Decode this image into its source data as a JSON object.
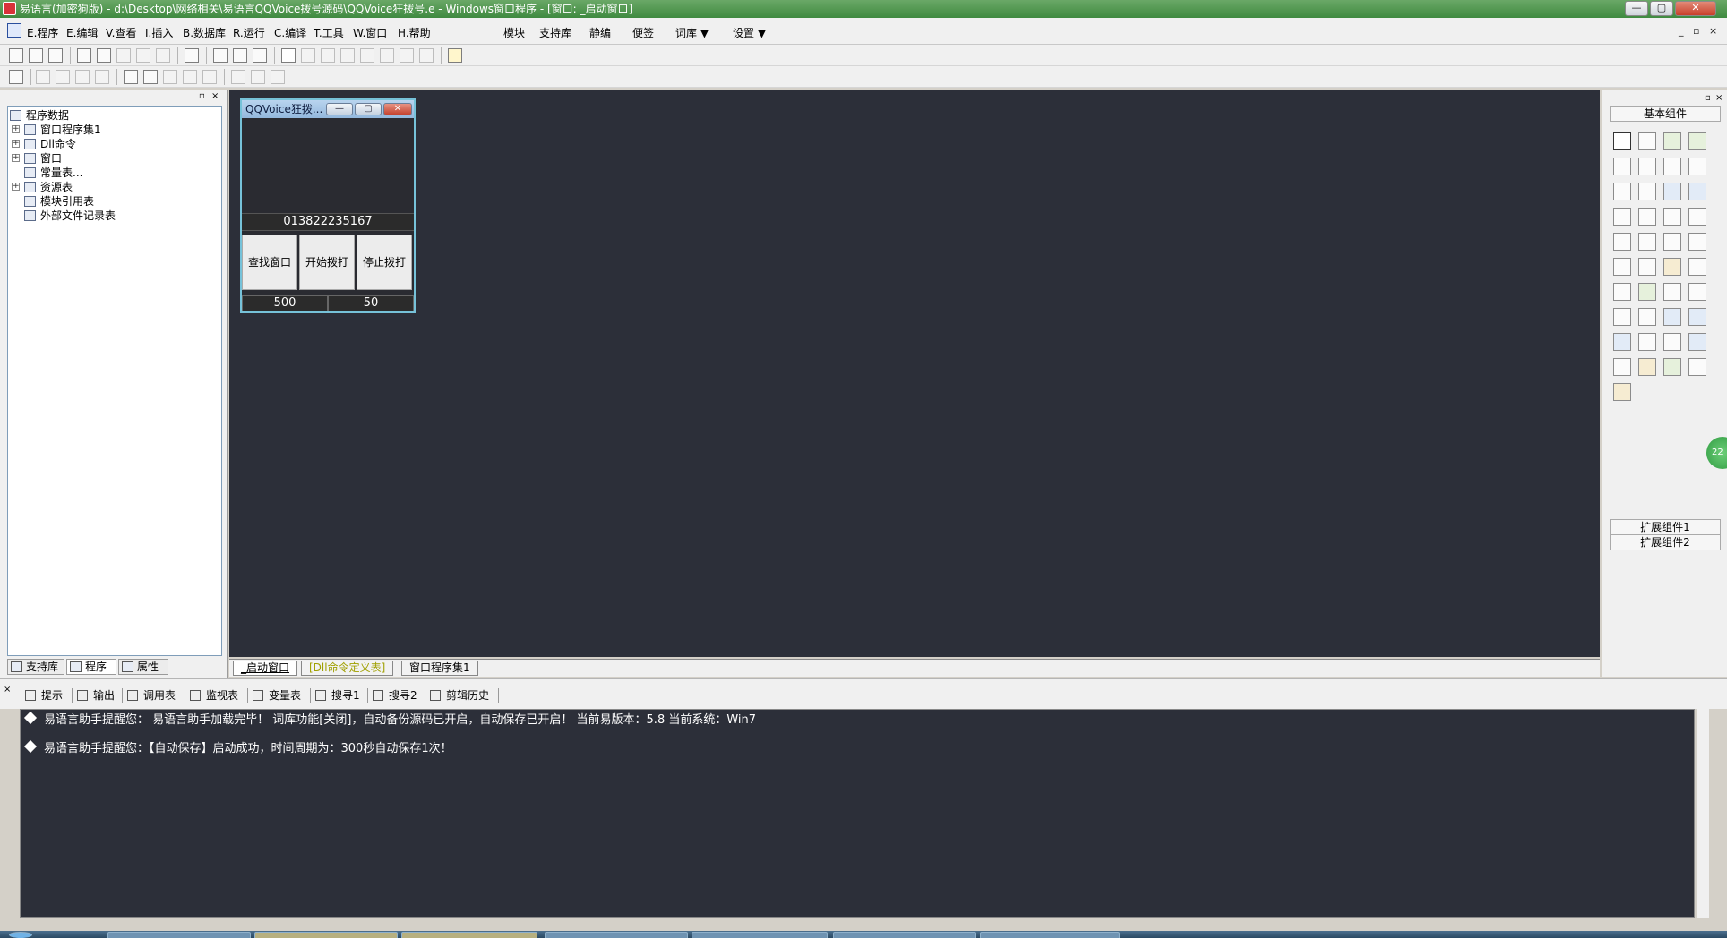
{
  "window": {
    "title": "易语言(加密狗版) - d:\\Desktop\\网络相关\\易语言QQVoice拨号源码\\QQVoice狂拨号.e - Windows窗口程序 - [窗口: _启动窗口]",
    "min_label": "—",
    "max_label": "▢",
    "close_label": "✕"
  },
  "menu": {
    "items": [
      {
        "label": "E.程序"
      },
      {
        "label": "E.编辑"
      },
      {
        "label": "V.查看"
      },
      {
        "label": "I.插入"
      },
      {
        "label": "B.数据库"
      },
      {
        "label": "R.运行"
      },
      {
        "label": "C.编译"
      },
      {
        "label": "T.工具"
      },
      {
        "label": "W.窗口"
      },
      {
        "label": "H.帮助"
      }
    ],
    "extra": [
      {
        "label": "模块"
      },
      {
        "label": "支持库"
      },
      {
        "label": "静编"
      },
      {
        "label": "便签"
      },
      {
        "label": "词库 ▼"
      },
      {
        "label": "设置 ▼"
      }
    ],
    "mdi_min": "_",
    "mdi_restore": "▫",
    "mdi_close": "×"
  },
  "left_panel": {
    "pin": "▫",
    "close": "×",
    "tree": [
      {
        "label": "程序数据",
        "level": 0,
        "toggle": ""
      },
      {
        "label": "窗口程序集1",
        "level": 1,
        "toggle": "+"
      },
      {
        "label": "Dll命令",
        "level": 1,
        "toggle": "+"
      },
      {
        "label": "窗口",
        "level": 1,
        "toggle": "+"
      },
      {
        "label": "常量表...",
        "level": 1,
        "toggle": ""
      },
      {
        "label": "资源表",
        "level": 1,
        "toggle": "+"
      },
      {
        "label": "模块引用表",
        "level": 1,
        "toggle": ""
      },
      {
        "label": "外部文件记录表",
        "level": 1,
        "toggle": ""
      }
    ],
    "tabs": [
      {
        "label": "支持库"
      },
      {
        "label": "程序"
      },
      {
        "label": "属性"
      }
    ]
  },
  "form_window": {
    "title": "QQVoice狂拨...",
    "phone": "013822235167",
    "buttons": [
      {
        "label": "查找窗口"
      },
      {
        "label": "开始拨打"
      },
      {
        "label": "停止拨打"
      }
    ],
    "values": [
      "500",
      "50"
    ],
    "min_label": "—",
    "max_label": "▢",
    "close_label": "✕"
  },
  "editor_tabs": [
    {
      "label": "_启动窗口",
      "active": true
    },
    {
      "label": "[Dll命令定义表]",
      "active": false
    },
    {
      "label": "窗口程序集1",
      "active": false
    }
  ],
  "right_panel": {
    "title": "基本组件",
    "footer": [
      "扩展组件1",
      "扩展组件2"
    ],
    "pin": "▫",
    "close": "×"
  },
  "side_badge": "22",
  "output_tabs": [
    {
      "label": "提示"
    },
    {
      "label": "输出"
    },
    {
      "label": "调用表"
    },
    {
      "label": "监视表"
    },
    {
      "label": "变量表"
    },
    {
      "label": "搜寻1"
    },
    {
      "label": "搜寻2"
    },
    {
      "label": "剪辑历史"
    }
  ],
  "output_lines": [
    "易语言助手提醒您：  易语言助手加载完毕！  词库功能[关闭]，自动备份源码已开启，自动保存已开启！  当前易版本：5.8  当前系统：Win7",
    "易语言助手提醒您：【自动保存】启动成功，时间周期为：300秒自动保存1次！"
  ]
}
